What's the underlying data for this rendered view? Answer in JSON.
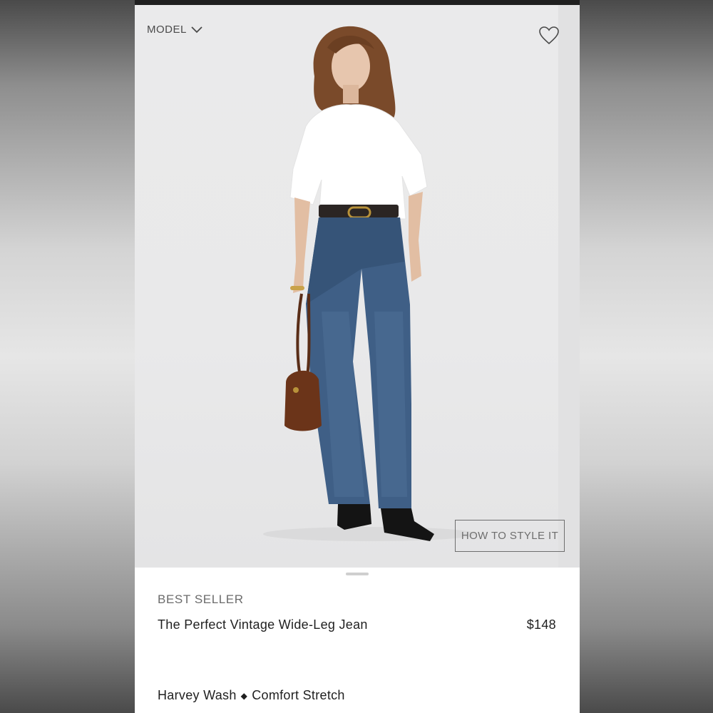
{
  "image": {
    "model_toggle_label": "MODEL",
    "style_button_label": "HOW TO STYLE IT",
    "icons": {
      "model_toggle": "chevron-down-icon",
      "wishlist": "heart-icon"
    }
  },
  "product": {
    "badge": "BEST SELLER",
    "name": "The Perfect Vintage Wide-Leg Jean",
    "price": "$148",
    "wash": "Harvey Wash",
    "separator": "◆",
    "fit": "Comfort Stretch"
  },
  "colors": {
    "text_primary": "#1f1f1f",
    "text_secondary": "#6b6b6b",
    "image_bg": "#eaeaeb",
    "button_border": "#6e6e6e"
  }
}
